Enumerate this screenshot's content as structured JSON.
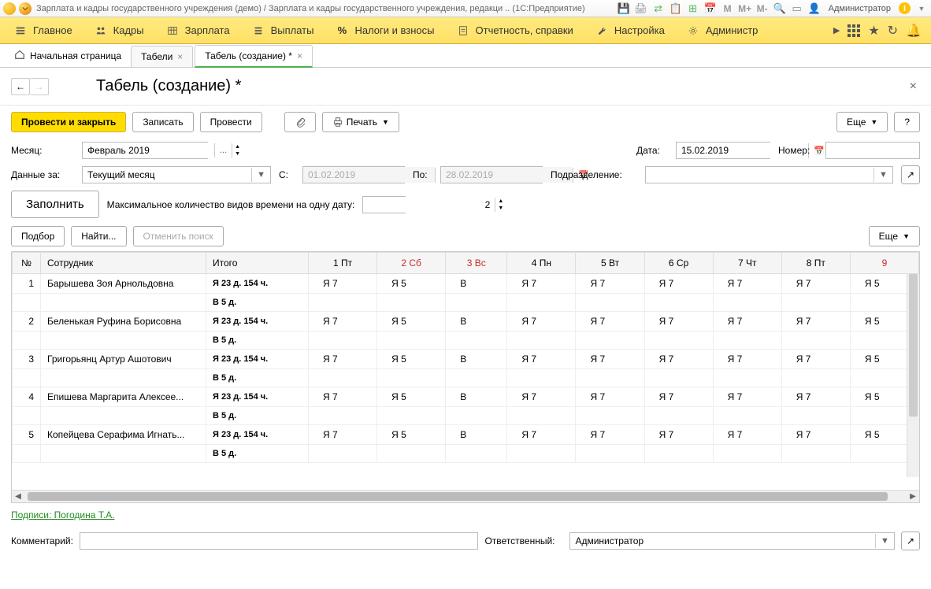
{
  "title_bar": {
    "text": "Зарплата и кадры государственного учреждения (демо) / Зарплата и кадры государственного учреждения, редакци .. (1С:Предприятие)",
    "user": "Администратор"
  },
  "main_menu": {
    "items": [
      "Главное",
      "Кадры",
      "Зарплата",
      "Выплаты",
      "Налоги и взносы",
      "Отчетность, справки",
      "Настройка",
      "Администр"
    ]
  },
  "tabs": {
    "home": "Начальная страница",
    "t1": "Табели",
    "t2": "Табель (создание) *"
  },
  "page": {
    "title": "Табель (создание) *"
  },
  "actions": {
    "save_close": "Провести и закрыть",
    "write": "Записать",
    "post": "Провести",
    "print": "Печать",
    "more": "Еще",
    "help": "?"
  },
  "form": {
    "month_label": "Месяц:",
    "month_value": "Февраль 2019",
    "date_label": "Дата:",
    "date_value": "15.02.2019",
    "number_label": "Номер:",
    "number_value": "",
    "data_for_label": "Данные за:",
    "data_for_value": "Текущий месяц",
    "from_label": "С:",
    "from_value": "01.02.2019",
    "to_label": "По:",
    "to_value": "28.02.2019",
    "dept_label": "Подразделение:",
    "dept_value": "",
    "fill_label": "Заполнить",
    "max_kinds_label": "Максимальное количество видов времени на одну дату:",
    "max_kinds_value": "2"
  },
  "table_toolbar": {
    "pick": "Подбор",
    "find": "Найти...",
    "cancel_find": "Отменить поиск",
    "more": "Еще"
  },
  "table": {
    "headers": {
      "num": "№",
      "employee": "Сотрудник",
      "total": "Итого",
      "days": [
        "1 Пт",
        "2 Сб",
        "3 Вс",
        "4 Пн",
        "5 Вт",
        "6 Ср",
        "7 Чт",
        "8 Пт",
        "9"
      ]
    },
    "weekend_idx": [
      1,
      2,
      8
    ],
    "rows": [
      {
        "n": "1",
        "name": "Барышева Зоя Арнольдовна",
        "total1": "Я 23 д. 154 ч.",
        "total2": "В 5 д.",
        "days": [
          "Я 7",
          "Я 5",
          "В",
          "Я 7",
          "Я 7",
          "Я 7",
          "Я 7",
          "Я 7",
          "Я 5"
        ]
      },
      {
        "n": "2",
        "name": "Беленькая Руфина Борисовна",
        "total1": "Я 23 д. 154 ч.",
        "total2": "В 5 д.",
        "days": [
          "Я 7",
          "Я 5",
          "В",
          "Я 7",
          "Я 7",
          "Я 7",
          "Я 7",
          "Я 7",
          "Я 5"
        ]
      },
      {
        "n": "3",
        "name": "Григорьянц Артур Ашотович",
        "total1": "Я 23 д. 154 ч.",
        "total2": "В 5 д.",
        "days": [
          "Я 7",
          "Я 5",
          "В",
          "Я 7",
          "Я 7",
          "Я 7",
          "Я 7",
          "Я 7",
          "Я 5"
        ]
      },
      {
        "n": "4",
        "name": "Епишева Маргарита Алексее...",
        "total1": "Я 23 д. 154 ч.",
        "total2": "В 5 д.",
        "days": [
          "Я 7",
          "Я 5",
          "В",
          "Я 7",
          "Я 7",
          "Я 7",
          "Я 7",
          "Я 7",
          "Я 5"
        ]
      },
      {
        "n": "5",
        "name": "Копейцева Серафима Игнать...",
        "total1": "Я 23 д. 154 ч.",
        "total2": "В 5 д.",
        "days": [
          "Я 7",
          "Я 5",
          "В",
          "Я 7",
          "Я 7",
          "Я 7",
          "Я 7",
          "Я 7",
          "Я 5"
        ]
      }
    ]
  },
  "link": "Подписи: Погодина Т.А.",
  "footer": {
    "comment_label": "Комментарий:",
    "comment_value": "",
    "resp_label": "Ответственный:",
    "resp_value": "Администратор"
  }
}
